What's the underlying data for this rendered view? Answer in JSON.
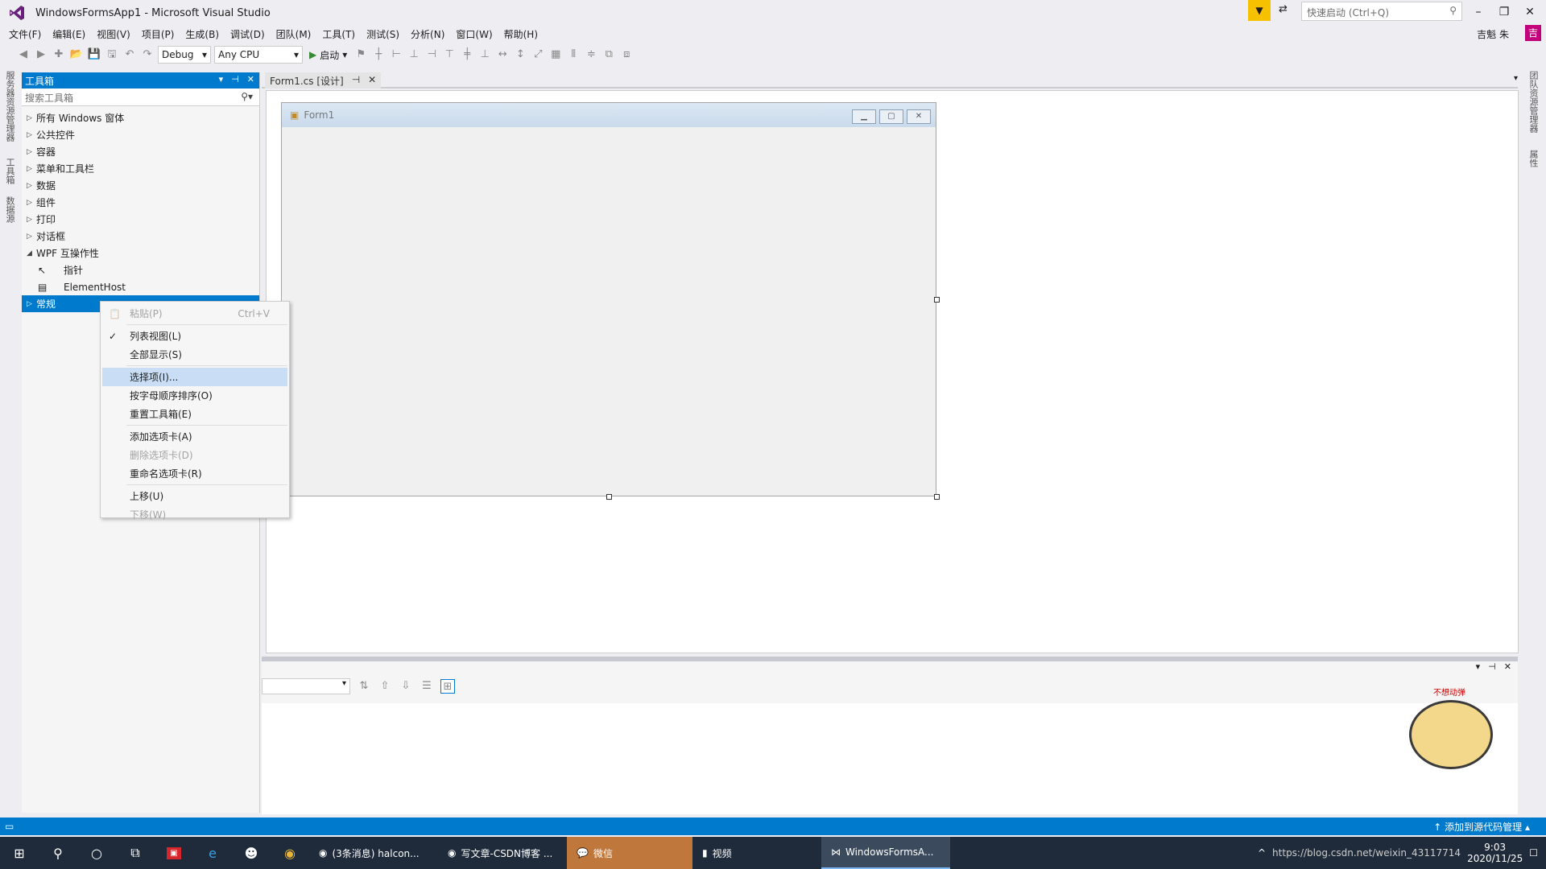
{
  "window": {
    "title": "WindowsFormsApp1 - Microsoft Visual Studio",
    "quick_launch_placeholder": "快速启动 (Ctrl+Q)",
    "user_name": "吉魁 朱",
    "user_initial": "吉"
  },
  "menu": [
    "文件(F)",
    "编辑(E)",
    "视图(V)",
    "项目(P)",
    "生成(B)",
    "调试(D)",
    "团队(M)",
    "工具(T)",
    "测试(S)",
    "分析(N)",
    "窗口(W)",
    "帮助(H)"
  ],
  "toolbar": {
    "config": "Debug",
    "platform": "Any CPU",
    "start_label": "启动"
  },
  "left_rail": [
    "服务器资源管理器",
    "工具箱",
    "数据源"
  ],
  "right_rail": [
    "团队资源管理器",
    "属性"
  ],
  "toolbox": {
    "title": "工具箱",
    "search_placeholder": "搜索工具箱",
    "categories": [
      {
        "label": "所有 Windows 窗体",
        "expanded": false
      },
      {
        "label": "公共控件",
        "expanded": false
      },
      {
        "label": "容器",
        "expanded": false
      },
      {
        "label": "菜单和工具栏",
        "expanded": false
      },
      {
        "label": "数据",
        "expanded": false
      },
      {
        "label": "组件",
        "expanded": false
      },
      {
        "label": "打印",
        "expanded": false
      },
      {
        "label": "对话框",
        "expanded": false
      },
      {
        "label": "WPF 互操作性",
        "expanded": true
      }
    ],
    "wpf_items": [
      "指针",
      "ElementHost"
    ],
    "selected_category": "常规"
  },
  "document": {
    "tab_label": "Form1.cs [设计]",
    "form_title": "Form1"
  },
  "context_menu": [
    {
      "label": "粘贴(P)",
      "shortcut": "Ctrl+V",
      "disabled": true,
      "checked": false,
      "active": false
    },
    {
      "sep": true
    },
    {
      "label": "列表视图(L)",
      "disabled": false,
      "checked": true,
      "active": false
    },
    {
      "label": "全部显示(S)",
      "disabled": false,
      "checked": false,
      "active": false
    },
    {
      "sep": true
    },
    {
      "label": "选择项(I)...",
      "disabled": false,
      "checked": false,
      "active": true
    },
    {
      "label": "按字母顺序排序(O)",
      "disabled": false,
      "checked": false,
      "active": false
    },
    {
      "label": "重置工具箱(E)",
      "disabled": false,
      "checked": false,
      "active": false
    },
    {
      "sep": true
    },
    {
      "label": "添加选项卡(A)",
      "disabled": false,
      "checked": false,
      "active": false
    },
    {
      "label": "删除选项卡(D)",
      "disabled": true,
      "checked": false,
      "active": false
    },
    {
      "label": "重命名选项卡(R)",
      "disabled": false,
      "checked": false,
      "active": false
    },
    {
      "sep": true
    },
    {
      "label": "上移(U)",
      "disabled": false,
      "checked": false,
      "active": false
    },
    {
      "label": "下移(W)",
      "disabled": true,
      "checked": false,
      "active": false
    }
  ],
  "status": {
    "right_text": "添加到源代码管理"
  },
  "taskbar": {
    "apps": [
      {
        "label": "(3条消息) halcon...",
        "icon": "chrome-icon"
      },
      {
        "label": "写文章-CSDN博客 ...",
        "icon": "chrome-icon"
      },
      {
        "label": "微信",
        "icon": "wechat-icon"
      },
      {
        "label": "视频",
        "icon": "folder-icon"
      },
      {
        "label": "WindowsFormsA...",
        "icon": "visual-studio-icon"
      }
    ],
    "time": "9:03",
    "date": "2020/11/25",
    "watermark": "https://blog.csdn.net/weixin_43117714"
  },
  "mascot_text": "不想动弹",
  "colors": {
    "accent": "#007acc",
    "selection": "#c9def5",
    "vs_purple": "#68217a"
  }
}
